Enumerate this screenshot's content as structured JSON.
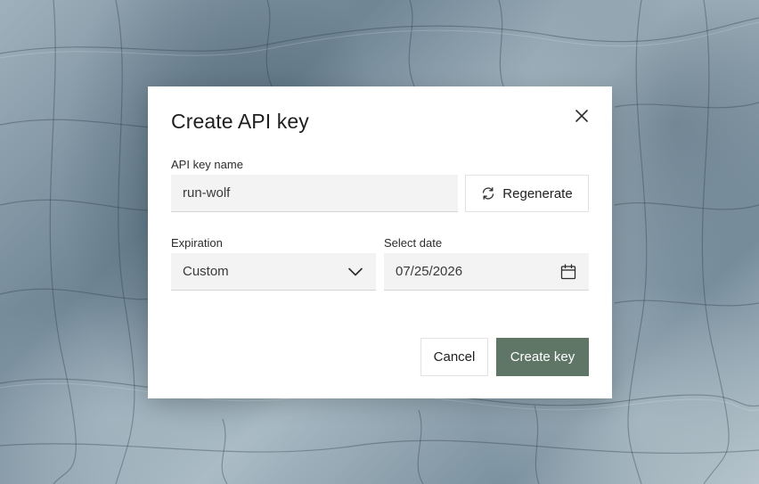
{
  "dialog": {
    "title": "Create API key",
    "close_icon": "close-icon"
  },
  "api_key": {
    "label": "API key name",
    "value": "run-wolf",
    "regenerate_label": "Regenerate",
    "regenerate_icon": "refresh-icon"
  },
  "expiration": {
    "label": "Expiration",
    "selected": "Custom",
    "icon": "chevron-down-icon"
  },
  "date": {
    "label": "Select date",
    "value": "07/25/2026",
    "icon": "calendar-icon"
  },
  "actions": {
    "cancel_label": "Cancel",
    "create_label": "Create key"
  },
  "colors": {
    "primary_button": "#5f7566",
    "input_background": "#f3f3f3"
  }
}
